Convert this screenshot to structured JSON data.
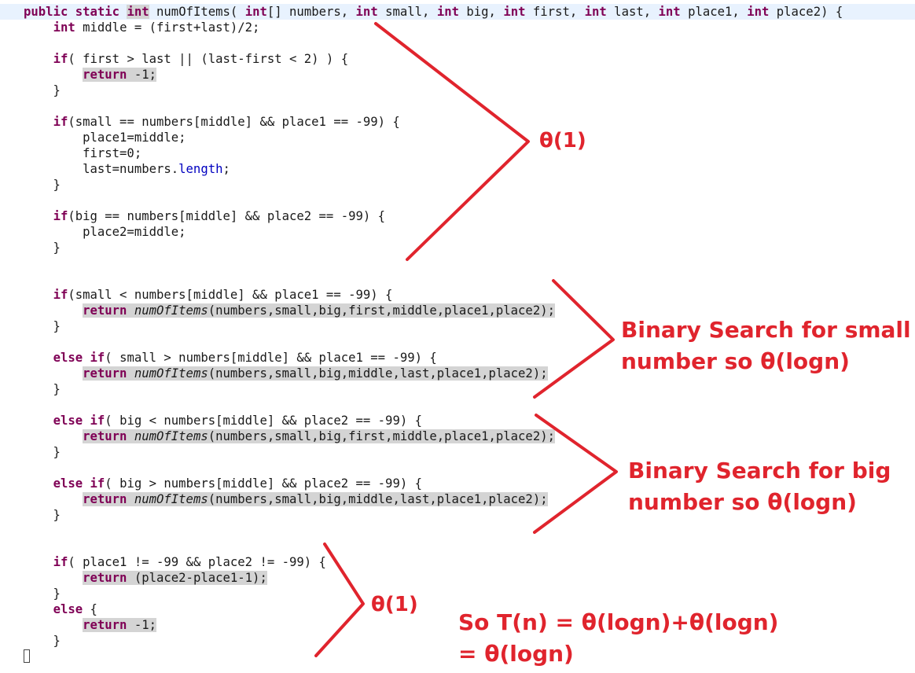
{
  "code_lines": [
    [
      [
        "kw",
        "public"
      ],
      [
        "t",
        " "
      ],
      [
        "kw",
        "static"
      ],
      [
        "t",
        " "
      ],
      [
        "kwsel",
        "int"
      ],
      [
        "t",
        " numOfItems( "
      ],
      [
        "kw",
        "int"
      ],
      [
        "t",
        "[] numbers, "
      ],
      [
        "kw",
        "int"
      ],
      [
        "t",
        " small, "
      ],
      [
        "kw",
        "int"
      ],
      [
        "t",
        " big, "
      ],
      [
        "kw",
        "int"
      ],
      [
        "t",
        " first, "
      ],
      [
        "kw",
        "int"
      ],
      [
        "t",
        " last, "
      ],
      [
        "kw",
        "int"
      ],
      [
        "t",
        " place1, "
      ],
      [
        "kw",
        "int"
      ],
      [
        "t",
        " place2) {"
      ]
    ],
    [
      [
        "t",
        "    "
      ],
      [
        "kw",
        "int"
      ],
      [
        "t",
        " middle = (first+last)/2;"
      ]
    ],
    [],
    [
      [
        "t",
        "    "
      ],
      [
        "kw",
        "if"
      ],
      [
        "t",
        "( first > last || (last-first < 2) ) {"
      ]
    ],
    [
      [
        "t",
        "        "
      ],
      [
        "kwsel",
        "return"
      ],
      [
        "sel",
        " -1;"
      ]
    ],
    [
      [
        "t",
        "    }"
      ]
    ],
    [],
    [
      [
        "t",
        "    "
      ],
      [
        "kw",
        "if"
      ],
      [
        "t",
        "(small == numbers[middle] && place1 == -99) {"
      ]
    ],
    [
      [
        "t",
        "        place1=middle;"
      ]
    ],
    [
      [
        "t",
        "        first=0;"
      ]
    ],
    [
      [
        "t",
        "        last=numbers."
      ],
      [
        "field",
        "length"
      ],
      [
        "t",
        ";"
      ]
    ],
    [
      [
        "t",
        "    }"
      ]
    ],
    [],
    [
      [
        "t",
        "    "
      ],
      [
        "kw",
        "if"
      ],
      [
        "t",
        "(big == numbers[middle] && place2 == -99) {"
      ]
    ],
    [
      [
        "t",
        "        place2=middle;"
      ]
    ],
    [
      [
        "t",
        "    }"
      ]
    ],
    [],
    [],
    [
      [
        "t",
        "    "
      ],
      [
        "kw",
        "if"
      ],
      [
        "t",
        "(small < numbers[middle] && place1 == -99) {"
      ]
    ],
    [
      [
        "t",
        "        "
      ],
      [
        "kwsel",
        "return"
      ],
      [
        "sel",
        " "
      ],
      [
        "itsel",
        "numOfItems"
      ],
      [
        "sel",
        "(numbers,small,big,first,middle,place1,place2);"
      ]
    ],
    [
      [
        "t",
        "    }"
      ]
    ],
    [],
    [
      [
        "t",
        "    "
      ],
      [
        "kw",
        "else"
      ],
      [
        "t",
        " "
      ],
      [
        "kw",
        "if"
      ],
      [
        "t",
        "( small > numbers[middle] && place1 == -99) {"
      ]
    ],
    [
      [
        "t",
        "        "
      ],
      [
        "kwsel",
        "return"
      ],
      [
        "sel",
        " "
      ],
      [
        "itsel",
        "numOfItems"
      ],
      [
        "sel",
        "(numbers,small,big,middle,last,place1,place2);"
      ]
    ],
    [
      [
        "t",
        "    }"
      ]
    ],
    [],
    [
      [
        "t",
        "    "
      ],
      [
        "kw",
        "else"
      ],
      [
        "t",
        " "
      ],
      [
        "kw",
        "if"
      ],
      [
        "t",
        "( big < numbers[middle] && place2 == -99) {"
      ]
    ],
    [
      [
        "t",
        "        "
      ],
      [
        "kwsel",
        "return"
      ],
      [
        "sel",
        " "
      ],
      [
        "itsel",
        "numOfItems"
      ],
      [
        "sel",
        "(numbers,small,big,first,middle,place1,place2);"
      ]
    ],
    [
      [
        "t",
        "    }"
      ]
    ],
    [],
    [
      [
        "t",
        "    "
      ],
      [
        "kw",
        "else"
      ],
      [
        "t",
        " "
      ],
      [
        "kw",
        "if"
      ],
      [
        "t",
        "( big > numbers[middle] && place2 == -99) {"
      ]
    ],
    [
      [
        "t",
        "        "
      ],
      [
        "kwsel",
        "return"
      ],
      [
        "sel",
        " "
      ],
      [
        "itsel",
        "numOfItems"
      ],
      [
        "sel",
        "(numbers,small,big,middle,last,place1,place2);"
      ]
    ],
    [
      [
        "t",
        "    }"
      ]
    ],
    [],
    [],
    [
      [
        "t",
        "    "
      ],
      [
        "kw",
        "if"
      ],
      [
        "t",
        "( place1 != -99 && place2 != -99) {"
      ]
    ],
    [
      [
        "t",
        "        "
      ],
      [
        "kwsel",
        "return"
      ],
      [
        "sel",
        " (place2-place1-1);"
      ]
    ],
    [
      [
        "t",
        "    }"
      ]
    ],
    [
      [
        "t",
        "    "
      ],
      [
        "kw",
        "else"
      ],
      [
        "t",
        " {"
      ]
    ],
    [
      [
        "t",
        "        "
      ],
      [
        "kwsel",
        "return"
      ],
      [
        "sel",
        " -1;"
      ]
    ],
    [
      [
        "t",
        "    }"
      ]
    ],
    [
      [
        "fold",
        ""
      ]
    ]
  ],
  "annotations": {
    "theta1_top": "θ(1)",
    "binary_small_line1": "Binary Search for small",
    "binary_small_line2": "number so θ(logn)",
    "binary_big_line1": "Binary Search for big",
    "binary_big_line2": "number so θ(logn)",
    "theta1_bottom": "θ(1)",
    "total_line1": "So T(n) = θ(logn)+θ(logn)",
    "total_line2": "= θ(logn)"
  },
  "colors": {
    "annotation": "#e0242d",
    "keyword": "#7f0055",
    "field": "#0000c0",
    "selection": "#d4d4d4",
    "current_line": "#e8f2fe"
  }
}
